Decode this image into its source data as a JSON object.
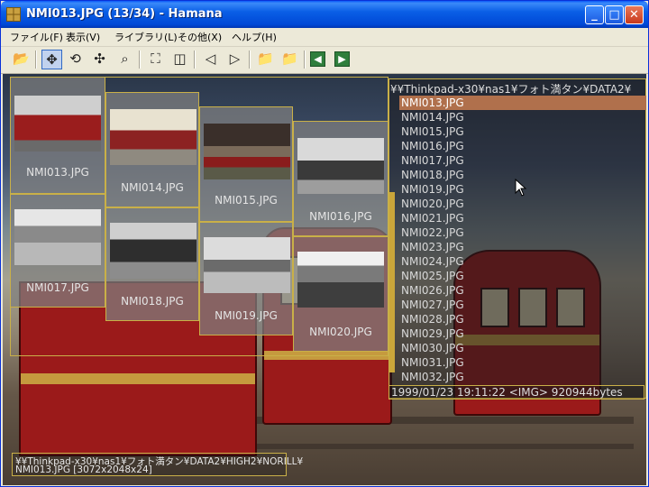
{
  "window": {
    "title": "NMI013.JPG (13/34) - Hamana",
    "controls": {
      "minimize": "_",
      "maximize": "□",
      "close": "✕"
    }
  },
  "menu": [
    "ファイル(F)",
    "表示(V)",
    "ライブラリ(L)",
    "その他(X)",
    "ヘルプ(H)"
  ],
  "toolbar": {
    "icons": [
      "open-folder-icon",
      "move-icon",
      "rotate-icon",
      "pan-icon",
      "magnifier-icon",
      "fit-window-icon",
      "two-page-icon",
      "prev-arrow-icon",
      "next-arrow-icon",
      "folder-prev-icon",
      "folder-next-icon",
      "back-icon",
      "forward-icon"
    ],
    "active": "move-icon"
  },
  "thumbnails": [
    {
      "label": "NMI013.JPG"
    },
    {
      "label": "NMI014.JPG"
    },
    {
      "label": "NMI015.JPG"
    },
    {
      "label": "NMI016.JPG"
    },
    {
      "label": "NMI017.JPG"
    },
    {
      "label": "NMI018.JPG"
    },
    {
      "label": "NMI019.JPG"
    },
    {
      "label": "NMI020.JPG"
    }
  ],
  "file_list": {
    "path": "¥¥Thinkpad-x30¥nas1¥フォト満タン¥DATA2¥",
    "items": [
      "NMI013.JPG",
      "NMI014.JPG",
      "NMI015.JPG",
      "NMI016.JPG",
      "NMI017.JPG",
      "NMI018.JPG",
      "NMI019.JPG",
      "NMI020.JPG",
      "NMI021.JPG",
      "NMI022.JPG",
      "NMI023.JPG",
      "NMI024.JPG",
      "NMI025.JPG",
      "NMI026.JPG",
      "NMI027.JPG",
      "NMI028.JPG",
      "NMI029.JPG",
      "NMI030.JPG",
      "NMI031.JPG",
      "NMI032.JPG"
    ],
    "selected_index": 0,
    "info": "1999/01/23 19:11:22 <IMG> 920944bytes"
  },
  "status": {
    "path": "¥¥Thinkpad-x30¥nas1¥フォト満タン¥DATA2¥HIGH2¥NORILL¥",
    "file": "NMI013.JPG [3072x2048x24]"
  },
  "colors": {
    "accent_border": "#c9b048",
    "selection": "#b0704c",
    "titlebar": "#0a5fe6"
  }
}
